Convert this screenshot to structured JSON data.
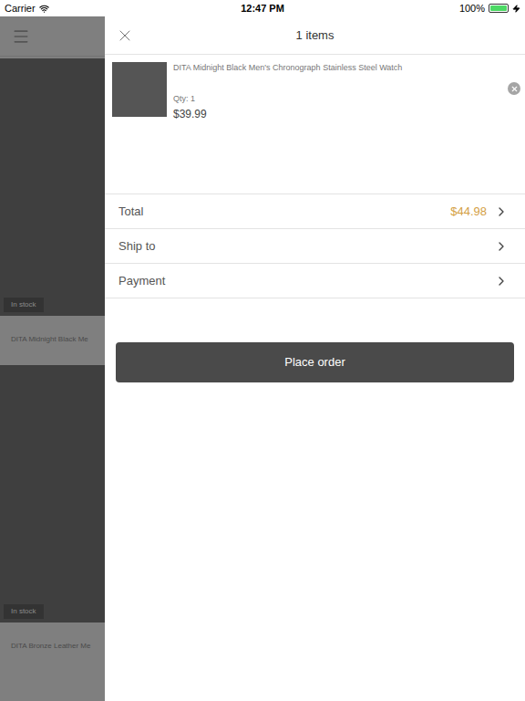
{
  "status_bar": {
    "carrier": "Carrier",
    "time": "12:47 PM",
    "battery": "100%",
    "battery_level": 1
  },
  "background": {
    "products": [
      {
        "title": "DITA Midnight Black Me",
        "badge": "In stock"
      },
      {
        "title": "DITA Bronze Leather Me",
        "badge": "In stock"
      }
    ]
  },
  "cart": {
    "title": "1 items",
    "items": [
      {
        "name": "DITA Midnight Black Men's Chronograph Stainless Steel Watch",
        "qty": "Qty: 1",
        "price": "$39.99"
      }
    ],
    "rows": [
      {
        "label": "Total",
        "value": "$44.98"
      },
      {
        "label": "Ship to",
        "value": ""
      },
      {
        "label": "Payment",
        "value": ""
      }
    ],
    "place_order": "Place order"
  }
}
